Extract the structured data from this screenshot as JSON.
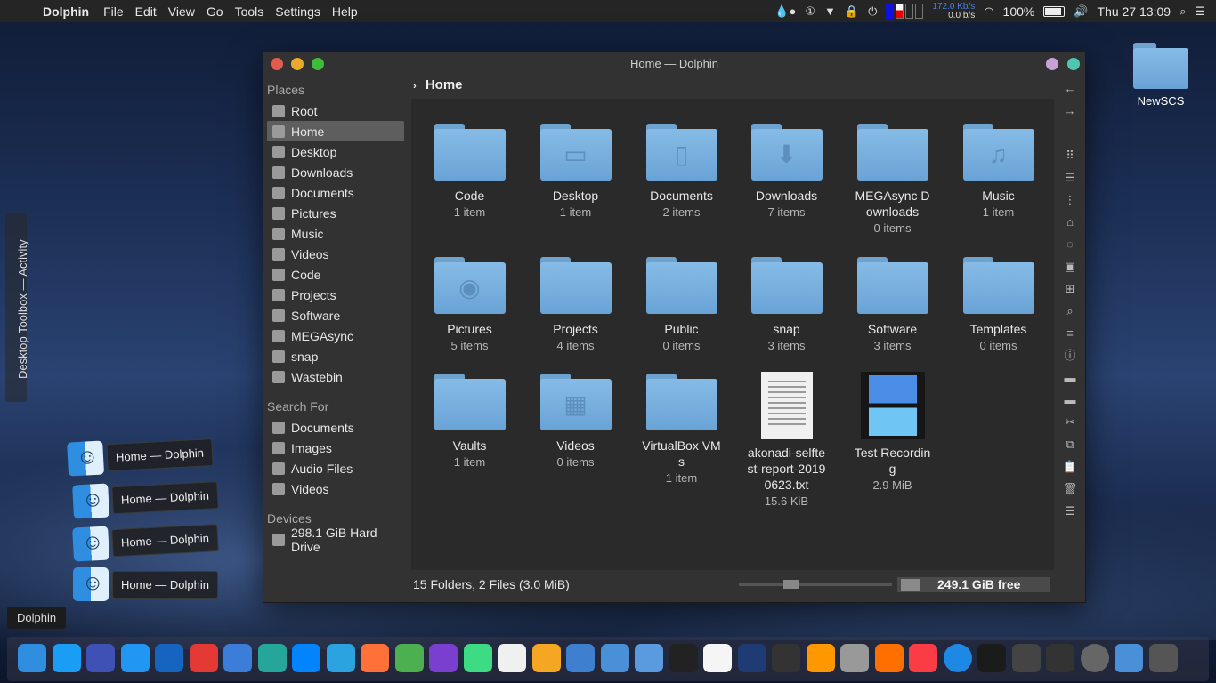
{
  "menubar": {
    "app_name": "Dolphin",
    "menus": [
      "File",
      "Edit",
      "View",
      "Go",
      "Tools",
      "Settings",
      "Help"
    ],
    "net_up": "172.0 Kb/s",
    "net_down": "0.0 b/s",
    "battery": "100%",
    "clock": "Thu 27  13:09"
  },
  "desktop_icon": {
    "label": "NewSCS"
  },
  "activity_panel": {
    "label": "Desktop Toolbox — Activity"
  },
  "stacked_windows": [
    "Home — Dolphin",
    "Home — Dolphin",
    "Home — Dolphin",
    "Home — Dolphin"
  ],
  "window": {
    "title": "Home — Dolphin",
    "breadcrumb": "Home",
    "places_header": "Places",
    "places": [
      {
        "label": "Root"
      },
      {
        "label": "Home",
        "selected": true
      },
      {
        "label": "Desktop"
      },
      {
        "label": "Downloads"
      },
      {
        "label": "Documents"
      },
      {
        "label": "Pictures"
      },
      {
        "label": "Music"
      },
      {
        "label": "Videos"
      },
      {
        "label": "Code"
      },
      {
        "label": "Projects"
      },
      {
        "label": "Software"
      },
      {
        "label": "MEGAsync"
      },
      {
        "label": "snap"
      },
      {
        "label": "Wastebin"
      }
    ],
    "search_header": "Search For",
    "search_items": [
      {
        "label": "Documents"
      },
      {
        "label": "Images"
      },
      {
        "label": "Audio Files"
      },
      {
        "label": "Videos"
      }
    ],
    "devices_header": "Devices",
    "devices": [
      {
        "label": "298.1 GiB Hard Drive"
      }
    ],
    "items": [
      {
        "name": "Code",
        "count": "1 item",
        "type": "folder",
        "glyph": ""
      },
      {
        "name": "Desktop",
        "count": "1 item",
        "type": "folder",
        "glyph": "▭"
      },
      {
        "name": "Documents",
        "count": "2 items",
        "type": "folder",
        "glyph": "▯"
      },
      {
        "name": "Downloads",
        "count": "7 items",
        "type": "folder",
        "glyph": "⬇"
      },
      {
        "name": "MEGAsync Downloads",
        "count": "0 items",
        "type": "folder",
        "glyph": ""
      },
      {
        "name": "Music",
        "count": "1 item",
        "type": "folder",
        "glyph": "♫"
      },
      {
        "name": "Pictures",
        "count": "5 items",
        "type": "folder",
        "glyph": "◉"
      },
      {
        "name": "Projects",
        "count": "4 items",
        "type": "folder",
        "glyph": ""
      },
      {
        "name": "Public",
        "count": "0 items",
        "type": "folder",
        "glyph": ""
      },
      {
        "name": "snap",
        "count": "3 items",
        "type": "folder",
        "glyph": ""
      },
      {
        "name": "Software",
        "count": "3 items",
        "type": "folder",
        "glyph": ""
      },
      {
        "name": "Templates",
        "count": "0 items",
        "type": "folder",
        "glyph": ""
      },
      {
        "name": "Vaults",
        "count": "1 item",
        "type": "folder",
        "glyph": ""
      },
      {
        "name": "Videos",
        "count": "0 items",
        "type": "folder",
        "glyph": "▦"
      },
      {
        "name": "VirtualBox VMs",
        "count": "1 item",
        "type": "folder",
        "glyph": ""
      },
      {
        "name": "akonadi-selftest-report-20190623.txt",
        "count": "15.6 KiB",
        "type": "text"
      },
      {
        "name": "Test Recording",
        "count": "2.9 MiB",
        "type": "video"
      }
    ],
    "status_text": "15 Folders, 2 Files (3.0 MiB)",
    "free_space": "249.1 GiB free"
  },
  "tooltip": "Dolphin",
  "dock_colors": [
    "#2f8ee0",
    "#1a9df5",
    "#3f51b5",
    "#2196f3",
    "#1565c0",
    "#e53935",
    "#3b7dd8",
    "#26a69a",
    "#0084ff",
    "#2aa3e0",
    "#ff7139",
    "#4caf50",
    "#7b3fd0",
    "#3ddc84",
    "#f0f0f0",
    "#f5a623",
    "#3f7fd0",
    "#4a90d9",
    "#5a9be0",
    "#222",
    "#f5f5f5",
    "#1f3b73",
    "#333",
    "#ff9800",
    "#999",
    "#ff6f00",
    "#fc3c44",
    "#1e88e5",
    "#1b1b1b",
    "#444",
    "#333",
    "#666",
    "#4a90d9",
    "#555"
  ]
}
